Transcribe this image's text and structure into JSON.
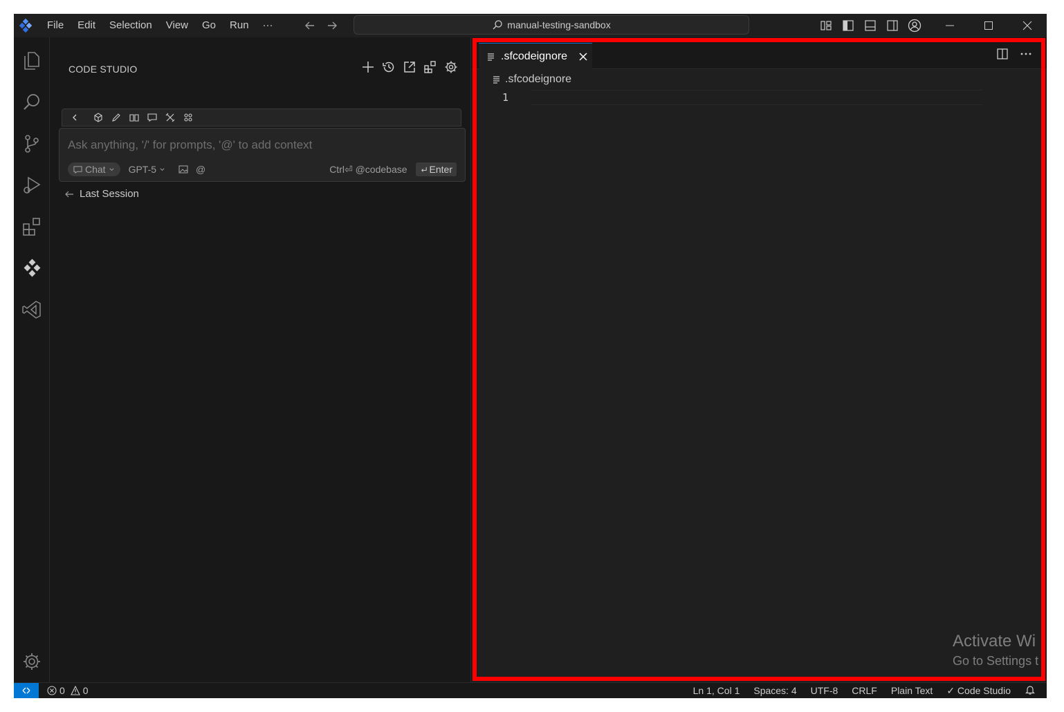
{
  "titlebar": {
    "menu": [
      "File",
      "Edit",
      "Selection",
      "View",
      "Go",
      "Run",
      "···"
    ],
    "search": "manual-testing-sandbox"
  },
  "sidebar": {
    "title": "CODE STUDIO",
    "chat": {
      "placeholder": "Ask anything, '/' for prompts, '@' to add context",
      "mode": "Chat",
      "model": "GPT-5",
      "at_symbol": "@",
      "shortcut": "Ctrl⏎",
      "codebase": "@codebase",
      "enter": "Enter"
    },
    "last_session": "Last Session"
  },
  "editor": {
    "tab_label": ".sfcodeignore",
    "breadcrumb": ".sfcodeignore",
    "line_numbers": [
      "1"
    ],
    "watermark_line1": "Activate Wi",
    "watermark_line2": "Go to Settings t"
  },
  "statusbar": {
    "errors": "0",
    "warnings": "0",
    "position": "Ln 1, Col 1",
    "spaces": "Spaces: 4",
    "encoding": "UTF-8",
    "eol": "CRLF",
    "language": "Plain Text",
    "extension": "✓ Code Studio"
  },
  "colors": {
    "accent": "#0078d4",
    "highlight": "#ff0000",
    "background": "#181818",
    "editor_bg": "#1f1f1f"
  }
}
